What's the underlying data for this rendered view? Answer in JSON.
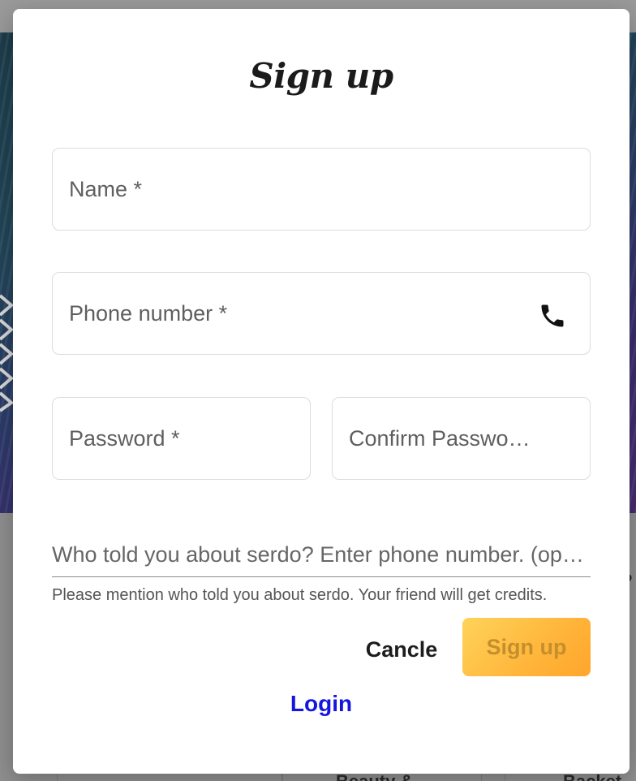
{
  "modal": {
    "title": "Sign up",
    "fields": {
      "name": {
        "placeholder": "Name *",
        "value": ""
      },
      "phone": {
        "placeholder": "Phone number *",
        "value": "",
        "icon": "phone-icon"
      },
      "password": {
        "placeholder": "Password *",
        "value": ""
      },
      "confirm_password": {
        "placeholder": "Confirm Passwo…",
        "value": ""
      },
      "referral": {
        "placeholder": "Who told you about serdo? Enter phone number. (op…",
        "value": ""
      }
    },
    "helper_text": "Please mention who told you about serdo. Your friend will get credits.",
    "cancel_label": "Cancle",
    "signup_label": "Sign up",
    "login_label": "Login"
  },
  "background": {
    "card_texts": [
      "Beauty &",
      "Backet"
    ],
    "script_fragment": "e"
  },
  "colors": {
    "accent": "#ffb53a",
    "link": "#1515e0",
    "signup_text": "#c58f2d"
  }
}
